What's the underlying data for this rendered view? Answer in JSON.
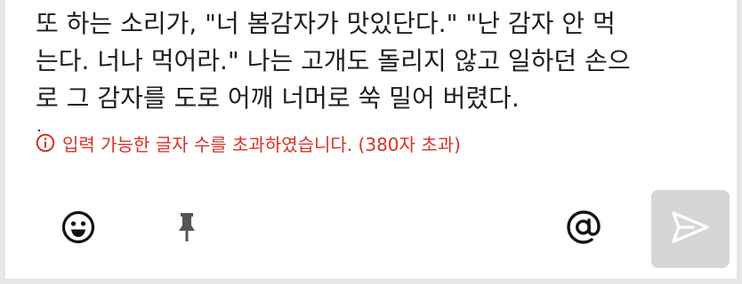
{
  "composer": {
    "lines": [
      "또 하는 소리가, \"너 봄감자가 맛있단다.\" \"난 감자 안 먹",
      "는다. 너나 먹어라.\" 나는 고개도 돌리지 않고 일하던 손으",
      "로 그 감자를 도로 어깨 너머로 쑥 밀어 버렸다."
    ],
    "error_message": "입력 가능한 글자 수를 초과하였습니다. (380자 초과)"
  },
  "toolbar": {
    "emoji_icon": "smiley-icon",
    "pin_icon": "pin-icon",
    "mention_icon": "at-icon",
    "send_icon": "send-icon",
    "send_disabled": true
  },
  "colors": {
    "error": "#d93025",
    "text": "#1e1e1e",
    "send_bg_disabled": "#d6d6d6",
    "border": "#e6e6e6"
  }
}
